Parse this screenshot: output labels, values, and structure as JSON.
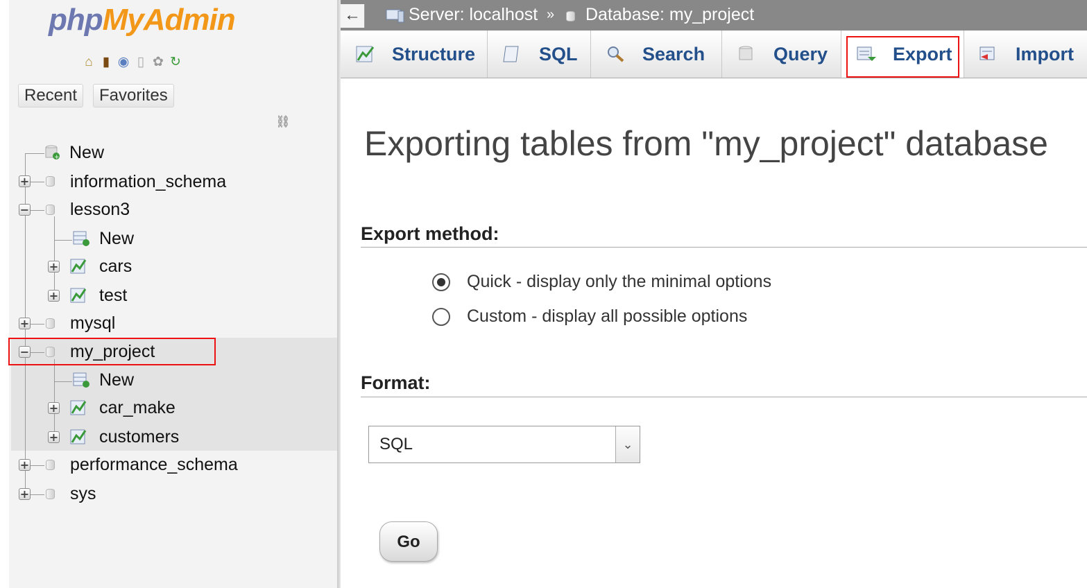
{
  "logo": {
    "part1": "php",
    "part2": "MyAdmin"
  },
  "nav": {
    "tabs": [
      "Recent",
      "Favorites"
    ],
    "tree": {
      "new": "New",
      "databases": [
        {
          "name": "information_schema",
          "expanded": false
        },
        {
          "name": "lesson3",
          "expanded": true,
          "children": [
            "New",
            "cars",
            "test"
          ]
        },
        {
          "name": "mysql",
          "expanded": false
        },
        {
          "name": "my_project",
          "expanded": true,
          "selected": true,
          "children": [
            "New",
            "car_make",
            "customers"
          ]
        },
        {
          "name": "performance_schema",
          "expanded": false
        },
        {
          "name": "sys",
          "expanded": false
        }
      ]
    }
  },
  "breadcrumb": {
    "server": "Server: localhost",
    "separator": "»",
    "database": "Database: my_project"
  },
  "tabs": [
    "Structure",
    "SQL",
    "Search",
    "Query",
    "Export",
    "Import"
  ],
  "active_tab": "Export",
  "page_title": "Exporting tables from \"my_project\" database",
  "export_method": {
    "heading": "Export method:",
    "options": [
      {
        "label": "Quick - display only the minimal options",
        "checked": true
      },
      {
        "label": "Custom - display all possible options",
        "checked": false
      }
    ]
  },
  "format": {
    "heading": "Format:",
    "selected": "SQL"
  },
  "go_button": "Go",
  "colors": {
    "highlight": "#ee1111",
    "tab_text": "#234f8a",
    "topbar": "#888888"
  }
}
